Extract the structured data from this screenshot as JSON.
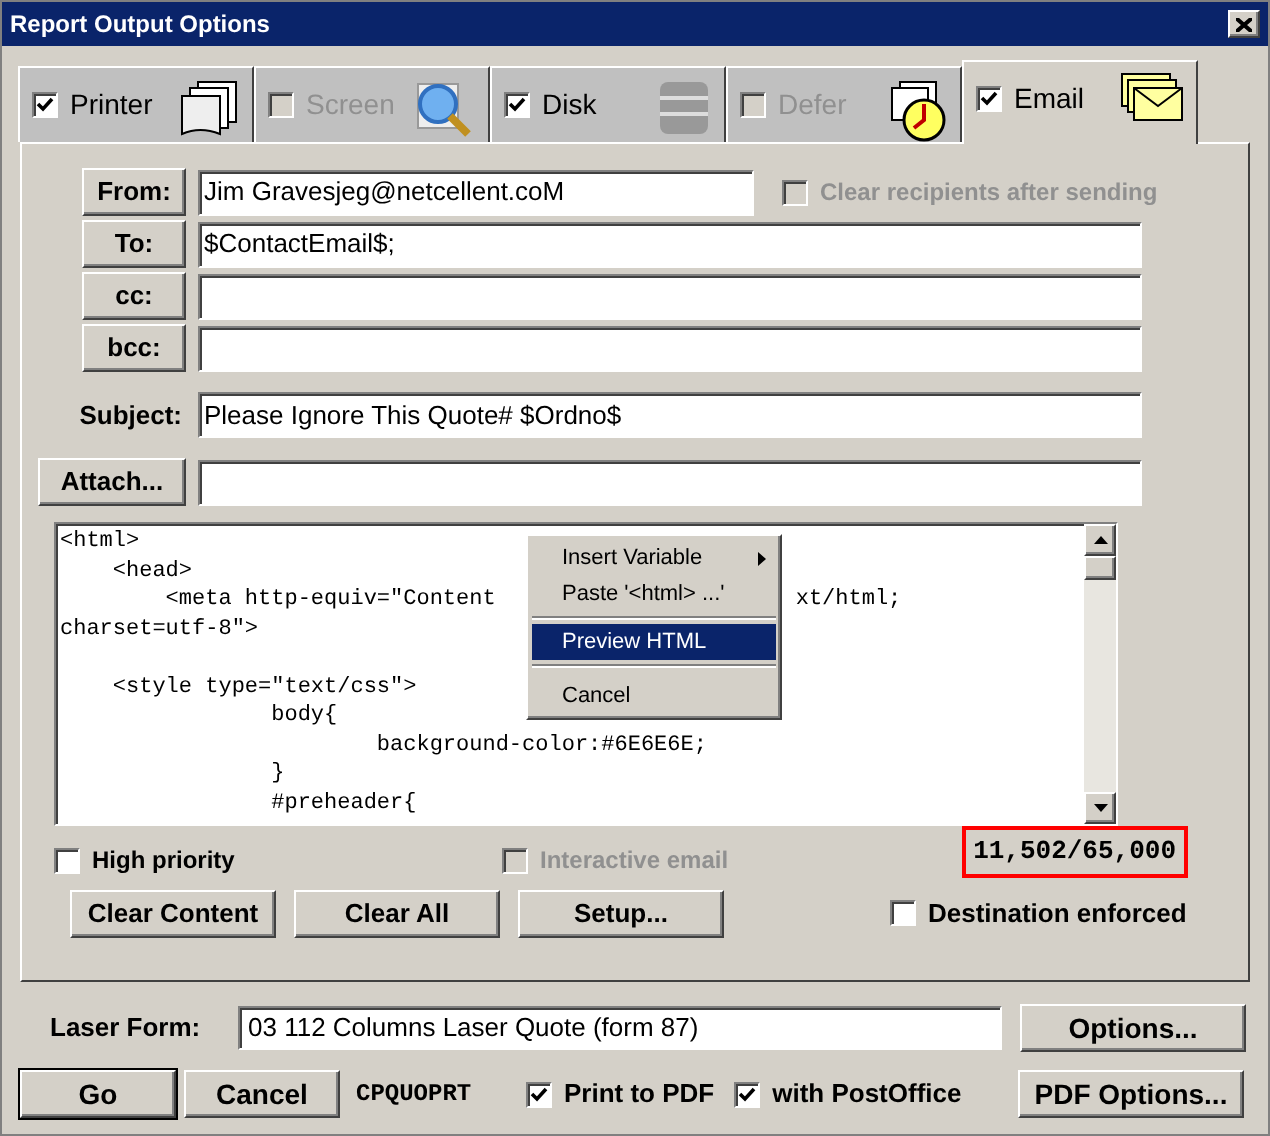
{
  "window": {
    "title": "Report Output Options"
  },
  "tabs": [
    {
      "label": "Printer",
      "checked": true,
      "disabled": false,
      "selected": false,
      "kind": "printer"
    },
    {
      "label": "Screen",
      "checked": false,
      "disabled": true,
      "selected": false,
      "kind": "screen"
    },
    {
      "label": "Disk",
      "checked": true,
      "disabled": false,
      "selected": false,
      "kind": "disk"
    },
    {
      "label": "Defer",
      "checked": false,
      "disabled": true,
      "selected": false,
      "kind": "defer"
    },
    {
      "label": "Email",
      "checked": true,
      "disabled": false,
      "selected": true,
      "kind": "email"
    }
  ],
  "clear_recipients": {
    "label": "Clear recipients after sending",
    "checked": false,
    "disabled": true
  },
  "fields": [
    {
      "button": "From:",
      "value": "Jim Gravesjeg@netcellent.coM",
      "kind": "button"
    },
    {
      "button": "To:",
      "value": "$ContactEmail$;",
      "kind": "button"
    },
    {
      "button": "cc:",
      "kind": "button"
    },
    {
      "button": "bcc:",
      "kind": "button"
    },
    {
      "button": "Subject:",
      "value": "Please Ignore This Quote# $Ordno$",
      "kind": "label"
    },
    {
      "button": "Attach...",
      "kind": "button"
    }
  ],
  "editor": {
    "paragraphs": [
      {
        "lines": [
          {
            "text": "<html> "
          },
          {
            "text": "    <head>"
          },
          {
            "text": "        <meta http-equiv=\"Content",
            "tail": "xt/html;"
          },
          {
            "text": "charset=utf-8\">"
          }
        ]
      },
      {
        "lines": [
          {
            "text": "    <style type=\"text/css\">"
          },
          {
            "text": "                body{"
          },
          {
            "text": "                        background-color:#6E6E6E;"
          },
          {
            "text": "                }"
          },
          {
            "text": "                #preheader{"
          }
        ]
      }
    ]
  },
  "context_menu": [
    {
      "items": [
        {
          "label": "Insert Variable",
          "submenu": true,
          "selected": false
        },
        {
          "label": "Paste '<html> ...'",
          "submenu": false,
          "selected": false
        }
      ]
    },
    {
      "items": [
        {
          "label": "Preview HTML",
          "submenu": false,
          "selected": true
        }
      ]
    },
    {
      "items": [
        {
          "label": "Cancel",
          "submenu": false,
          "selected": false
        }
      ]
    }
  ],
  "high_priority": {
    "label": "High priority",
    "checked": false,
    "disabled": false
  },
  "interactive_email": {
    "label": "Interactive email",
    "checked": false,
    "disabled": true
  },
  "counter": "11,502/65,000",
  "action_buttons": [
    "Clear Content",
    "Clear All",
    "Setup..."
  ],
  "destination_enforced": {
    "label": "Destination enforced",
    "checked": false
  },
  "laser_form": {
    "label": "Laser Form:",
    "value": "03 112 Columns Laser Quote (form 87)",
    "button": "Options..."
  },
  "footer": {
    "go": "Go",
    "cancel": "Cancel",
    "program": "CPQUOPRT",
    "print_to_pdf": {
      "label": "Print to PDF",
      "checked": true
    },
    "post_office": {
      "label": "with PostOffice",
      "checked": true
    },
    "pdf_options": "PDF Options..."
  }
}
